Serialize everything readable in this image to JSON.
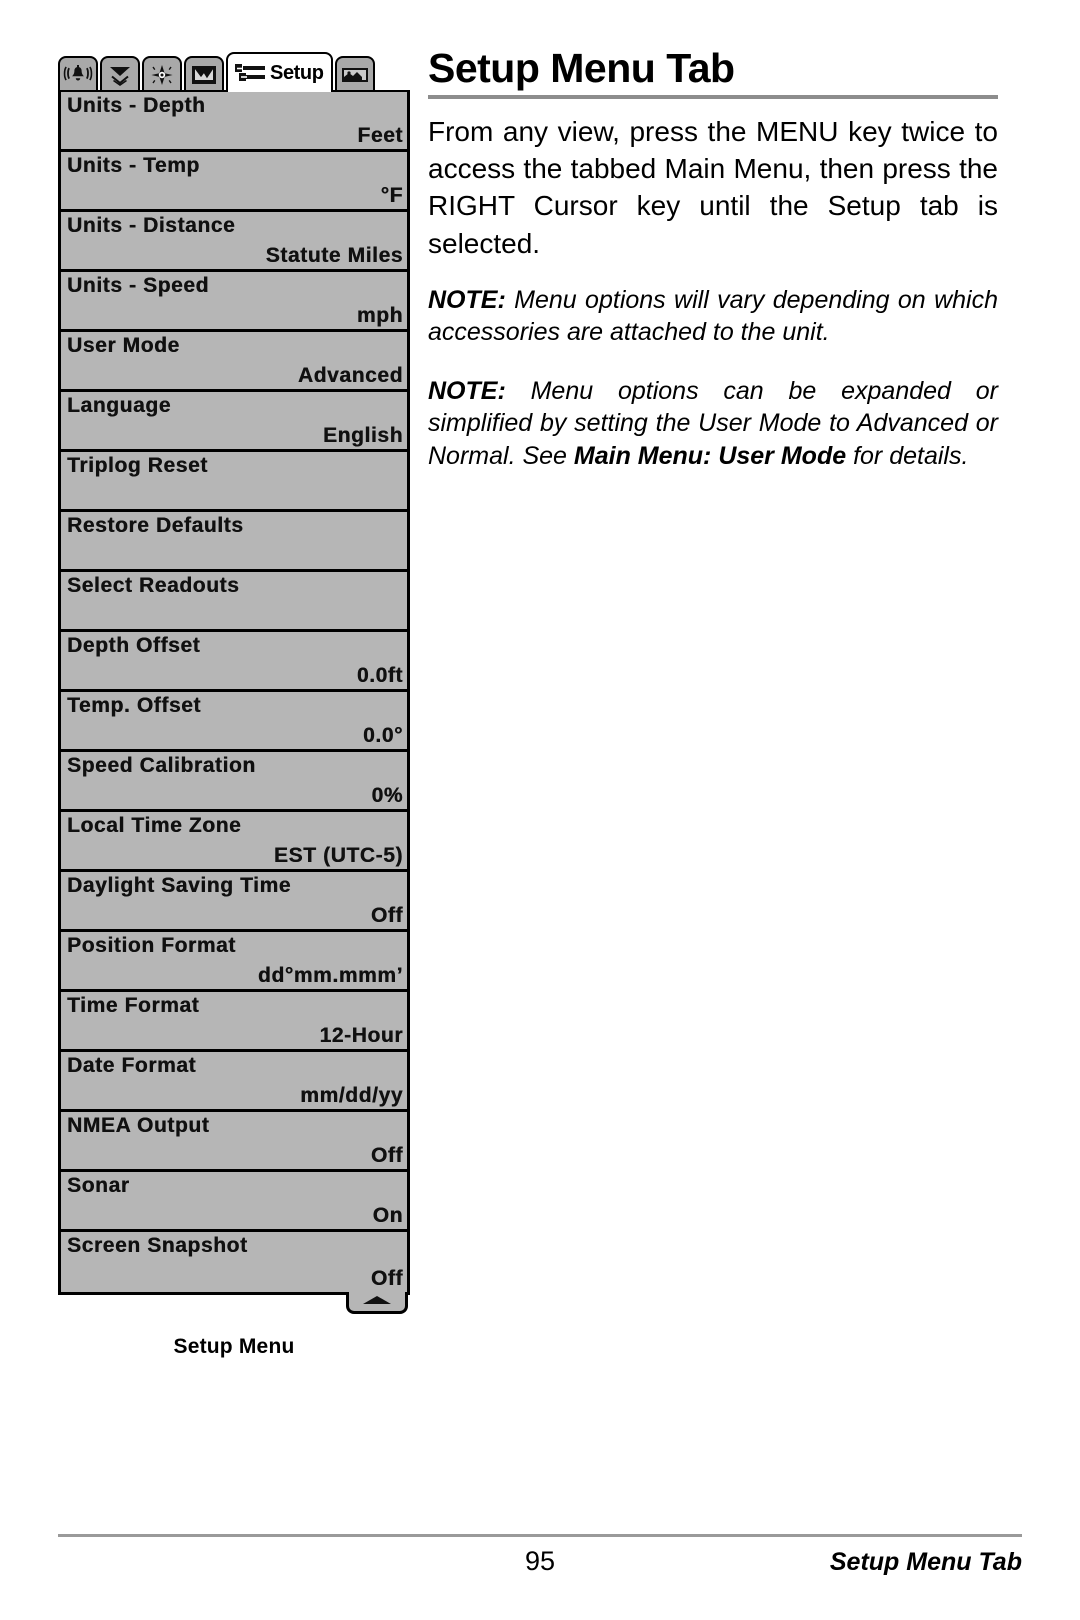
{
  "document": {
    "title": "Setup Menu Tab",
    "page_number": "95",
    "footer_title": "Setup Menu Tab"
  },
  "body": {
    "intro": "From any view, press the MENU key twice to access the tabbed Main Menu, then press the RIGHT Cursor key until the Setup tab is selected.",
    "note1_lead": "NOTE:",
    "note1_text": " Menu options will vary depending on which accessories are attached to the unit.",
    "note2_lead": "NOTE:",
    "note2_text_a": " Menu options can be expanded or simplified by setting the User Mode to Advanced or Normal. See ",
    "note2_bold": "Main Menu: User Mode",
    "note2_text_b": " for details."
  },
  "device": {
    "caption": "Setup Menu",
    "tabs": [
      {
        "icon": "alarm-bell-icon",
        "label": "",
        "selected": false
      },
      {
        "icon": "sonar-cone-icon",
        "label": "",
        "selected": false
      },
      {
        "icon": "navigation-star-icon",
        "label": "",
        "selected": false
      },
      {
        "icon": "chart-view-icon",
        "label": "",
        "selected": false
      },
      {
        "icon": "setup-wrench-icon",
        "label": "Setup",
        "selected": true
      },
      {
        "icon": "accessories-icon",
        "label": "",
        "selected": false
      }
    ],
    "scroll_arrow": "scroll-up-arrow-icon",
    "menu_items": [
      {
        "label": "Units - Depth",
        "value": "Feet"
      },
      {
        "label": "Units - Temp",
        "value": "°F"
      },
      {
        "label": "Units - Distance",
        "value": "Statute Miles"
      },
      {
        "label": "Units - Speed",
        "value": "mph"
      },
      {
        "label": "User Mode",
        "value": "Advanced"
      },
      {
        "label": "Language",
        "value": "English"
      },
      {
        "label": "Triplog Reset",
        "value": ""
      },
      {
        "label": "Restore Defaults",
        "value": ""
      },
      {
        "label": "Select Readouts",
        "value": ""
      },
      {
        "label": "Depth Offset",
        "value": "0.0ft"
      },
      {
        "label": "Temp. Offset",
        "value": "0.0°"
      },
      {
        "label": "Speed Calibration",
        "value": "0%"
      },
      {
        "label": "Local Time Zone",
        "value": "EST (UTC-5)"
      },
      {
        "label": "Daylight Saving Time",
        "value": "Off"
      },
      {
        "label": "Position Format",
        "value": "dd°mm.mmm’"
      },
      {
        "label": "Time Format",
        "value": "12-Hour"
      },
      {
        "label": "Date Format",
        "value": "mm/dd/yy"
      },
      {
        "label": "NMEA Output",
        "value": "Off"
      },
      {
        "label": "Sonar",
        "value": "On"
      },
      {
        "label": "Screen Snapshot",
        "value": "Off"
      }
    ]
  },
  "colors": {
    "screen_bg": "#b6b6b6",
    "tab_bg": "#a9a9a9",
    "selected_tab_bg": "#ffffff",
    "rule": "#8d8d8d",
    "text": "#000000"
  }
}
